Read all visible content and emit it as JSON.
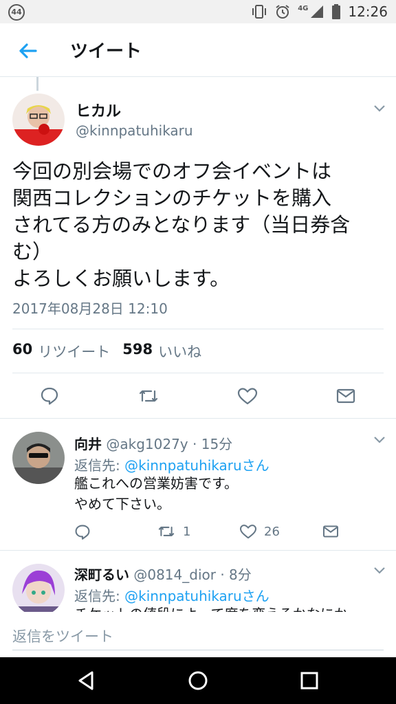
{
  "status_bar": {
    "badge": "44",
    "network": "4G",
    "time": "12:26"
  },
  "header": {
    "title": "ツイート"
  },
  "main_tweet": {
    "name": "ヒカル",
    "handle": "@kinnpatuhikaru",
    "text": "今回の別会場でのオフ会イベントは\n関西コレクションのチケットを購入\nされてる方のみとなります（当日券含\nむ）\nよろしくお願いします。",
    "timestamp": "2017年08月28日 12:10",
    "retweet_count": "60",
    "retweet_label": "リツイート",
    "like_count": "598",
    "like_label": "いいね"
  },
  "replies": [
    {
      "name": "向井",
      "handle": "@akg1027y",
      "time": "15分",
      "reply_to_label": "返信先:",
      "reply_to_link": "@kinnpatuhikaruさん",
      "text": "艦これへの営業妨害です。\nやめて下さい。",
      "retweets": "1",
      "likes": "26"
    },
    {
      "name": "深町るい",
      "handle": "@0814_dior",
      "time": "8分",
      "reply_to_label": "返信先:",
      "reply_to_link": "@kinnpatuhikaruさん",
      "text": "チケットの値段によって席を変えるかなにか"
    }
  ],
  "reply_box": {
    "placeholder": "返信をツイート"
  },
  "colors": {
    "accent": "#1da1f2",
    "muted": "#657786",
    "text": "#14171a"
  }
}
